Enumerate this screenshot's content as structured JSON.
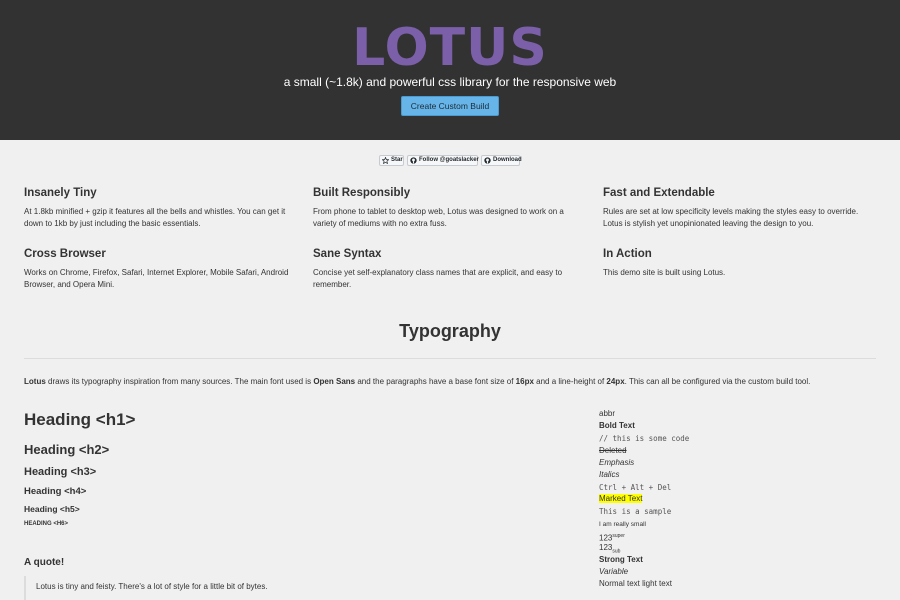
{
  "hero": {
    "logo": "LOTUS",
    "tagline": "a small (~1.8k) and powerful css library for the responsive web",
    "build_button": "Create Custom Build"
  },
  "github": {
    "star": "Star",
    "follow": "Follow @goatslacker",
    "download": "Download"
  },
  "features": [
    {
      "title": "Insanely Tiny",
      "desc": "At 1.8kb minified + gzip it features all the bells and whistles. You can get it down to 1kb by just including the basic essentials."
    },
    {
      "title": "Built Responsibly",
      "desc": "From phone to tablet to desktop web, Lotus was designed to work on a variety of mediums with no extra fuss."
    },
    {
      "title": "Fast and Extendable",
      "desc": "Rules are set at low specificity levels making the styles easy to override. Lotus is stylish yet unopinionated leaving the design to you."
    },
    {
      "title": "Cross Browser",
      "desc": "Works on Chrome, Firefox, Safari, Internet Explorer, Mobile Safari, Android Browser, and Opera Mini."
    },
    {
      "title": "Sane Syntax",
      "desc": "Concise yet self-explanatory class names that are explicit, and easy to remember."
    },
    {
      "title": "In Action",
      "desc": "This demo site is built using Lotus."
    }
  ],
  "typography": {
    "title": "Typography",
    "intro": {
      "lotus": "Lotus",
      "part1": " draws its typography inspiration from many sources. The main font used is ",
      "font": "Open Sans",
      "part2": " and the paragraphs have a base font size of ",
      "size": "16px",
      "part3": " and a line-height of ",
      "lh": "24px",
      "part4": ". This can all be configured via the custom build tool."
    },
    "headings": [
      "Heading <h1>",
      "Heading <h2>",
      "Heading <h3>",
      "Heading <h4>",
      "Heading <h5>",
      "Heading <h6>"
    ],
    "quote_title": "A quote!",
    "quote_text": "Lotus is tiny and feisty. There's a lot of style for a little bit of bytes."
  },
  "samples": {
    "abbr": "abbr",
    "bold": "Bold Text",
    "code": "// this is some code",
    "deleted": "Deleted",
    "emphasis": "Emphasis",
    "italics": "Italics",
    "kbd": "Ctrl + Alt + Del",
    "marked": "Marked Text",
    "samp": "This is a sample",
    "small": "I am really small",
    "sup_base": "123",
    "sup": "super",
    "sub_base": "123",
    "sub": "sub",
    "strong": "Strong Text",
    "variable": "Variable",
    "light": "Normal text light text"
  }
}
